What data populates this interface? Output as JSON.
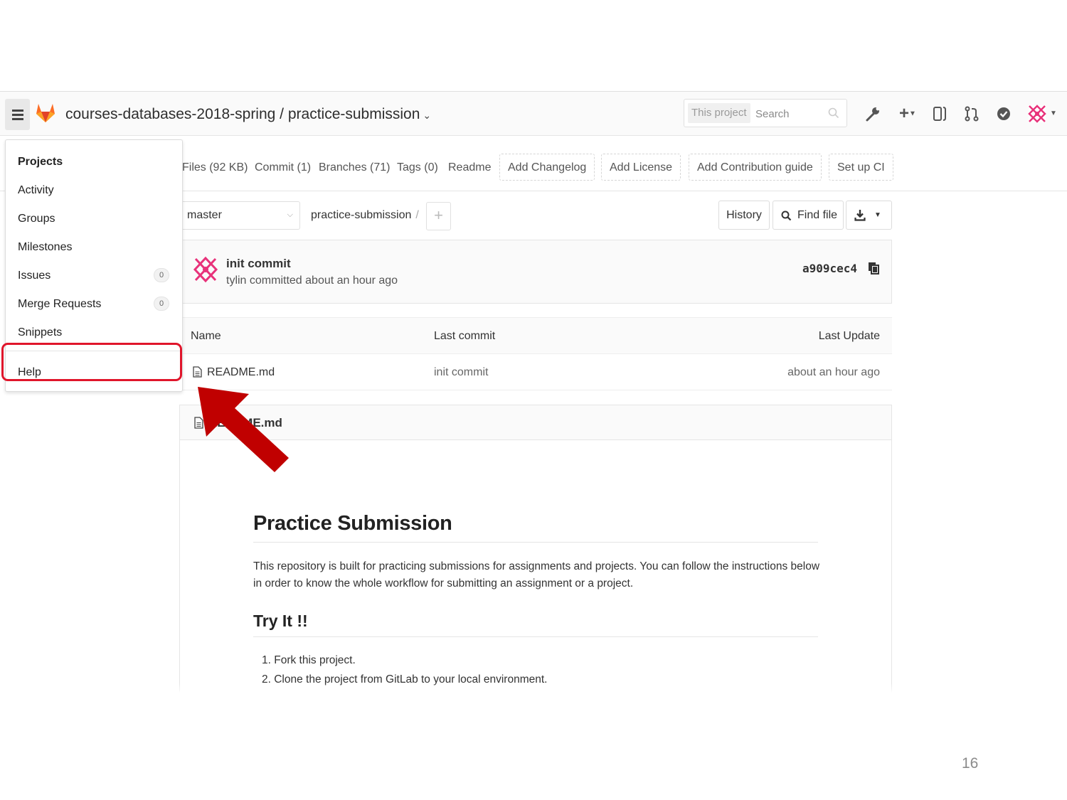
{
  "header": {
    "project_path": "courses-databases-2018-spring / practice-submission",
    "search_scope": "This project",
    "search_placeholder": "Search"
  },
  "subnav": {
    "files": "Files (92 KB)",
    "commits": "Commit (1)",
    "branches": "Branches (71)",
    "tags": "Tags (0)",
    "readme": "Readme",
    "add_changelog": "Add Changelog",
    "add_license": "Add License",
    "add_contribution": "Add Contribution guide",
    "setup_ci": "Set up CI"
  },
  "tree": {
    "branch": "master",
    "path": "practice-submission",
    "path_sep": "/",
    "history": "History",
    "find_file": "Find file"
  },
  "commit": {
    "title": "init commit",
    "meta": "tylin committed about an hour ago",
    "sha": "a909cec4"
  },
  "table": {
    "headers": [
      "Name",
      "Last commit",
      "Last Update"
    ],
    "rows": [
      {
        "name": "README.md",
        "last_commit": "init commit",
        "last_update": "about an hour ago"
      }
    ]
  },
  "readme": {
    "file": "README.md",
    "h1": "Practice Submission",
    "intro": "This repository is built for practicing submissions for assignments and projects. You can follow the instructions below in order to know the whole workflow for submitting an assignment or a project.",
    "h2": "Try It !!",
    "steps": [
      "1.  Fork this project.",
      "2.  Clone the project from GitLab to your local environment."
    ]
  },
  "menu": {
    "items": [
      {
        "label": "Projects"
      },
      {
        "label": "Activity"
      },
      {
        "label": "Groups"
      },
      {
        "label": "Milestones"
      },
      {
        "label": "Issues",
        "count": "0"
      },
      {
        "label": "Merge Requests",
        "count": "0"
      },
      {
        "label": "Snippets"
      },
      {
        "label": "Help"
      }
    ]
  },
  "colors": {
    "highlight": "#e0152b",
    "arrow": "#c00000",
    "gitlab_orange": "#fc6d26"
  },
  "slide_number": "16"
}
